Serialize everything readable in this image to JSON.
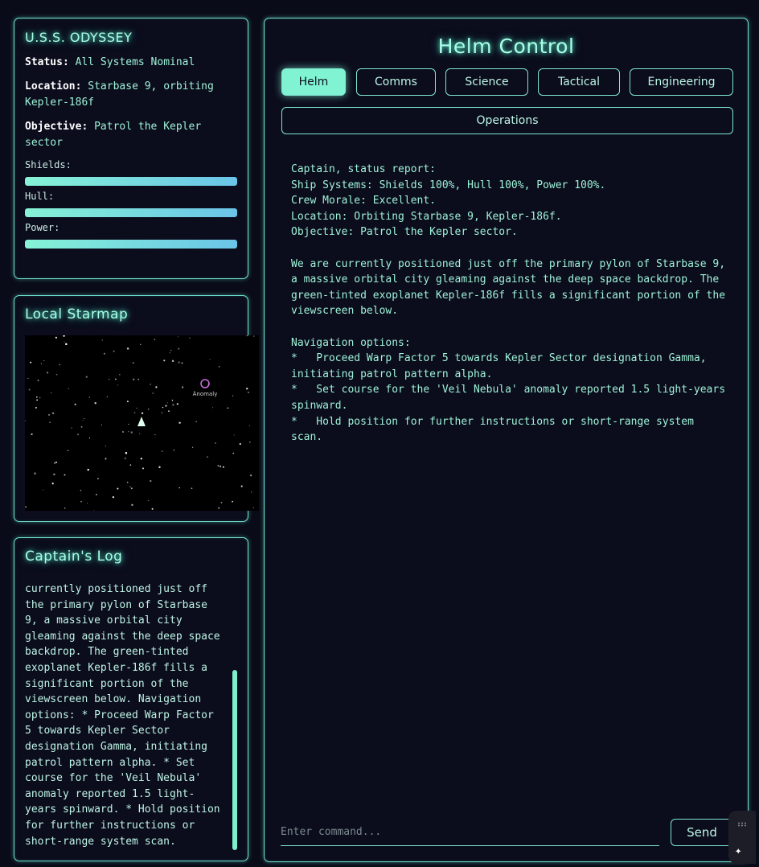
{
  "ship": {
    "name": "U.S.S. ODYSSEY",
    "status_label": "Status:",
    "status_value": "All Systems Nominal",
    "location_label": "Location:",
    "location_value": "Starbase 9, orbiting Kepler-186f",
    "objective_label": "Objective:",
    "objective_value": "Patrol the Kepler sector",
    "bars": [
      {
        "label": "Shields:",
        "value": 1.0
      },
      {
        "label": "Hull:",
        "value": 1.0
      },
      {
        "label": "Power:",
        "value": 1.0
      }
    ]
  },
  "starmap": {
    "title": "Local Starmap",
    "anomaly_label": "Anomaly"
  },
  "log": {
    "title": "Captain's Log",
    "text": "currently positioned just off the primary pylon of Starbase 9, a massive orbital city gleaming against the deep space backdrop. The green-tinted exoplanet Kepler-186f fills a significant portion of the viewscreen below. Navigation options: * Proceed Warp Factor 5 towards Kepler Sector designation Gamma, initiating patrol pattern alpha. * Set course for the 'Veil Nebula' anomaly reported 1.5 light-years spinward. * Hold position for further instructions or short-range system scan."
  },
  "helm": {
    "title": "Helm Control",
    "tabs": [
      "Helm",
      "Comms",
      "Science",
      "Tactical",
      "Engineering",
      "Operations"
    ],
    "active_tab": "Helm",
    "console_text": "Captain, status report:\nShip Systems: Shields 100%, Hull 100%, Power 100%.\nCrew Morale: Excellent.\nLocation: Orbiting Starbase 9, Kepler-186f.\nObjective: Patrol the Kepler sector.\n\nWe are currently positioned just off the primary pylon of Starbase 9, a massive orbital city gleaming against the deep space backdrop. The green-tinted exoplanet Kepler-186f fills a significant portion of the viewscreen below.\n\nNavigation options:\n*   Proceed Warp Factor 5 towards Kepler Sector designation Gamma, initiating patrol pattern alpha.\n*   Set course for the 'Veil Nebula' anomaly reported 1.5 light-years spinward.\n*   Hold position for further instructions or short-range system scan.",
    "input_placeholder": "Enter command...",
    "send_label": "Send"
  },
  "colors": {
    "accent": "#7ff3d2",
    "background": "#0a0b18",
    "anomaly": "#c86fe0"
  }
}
